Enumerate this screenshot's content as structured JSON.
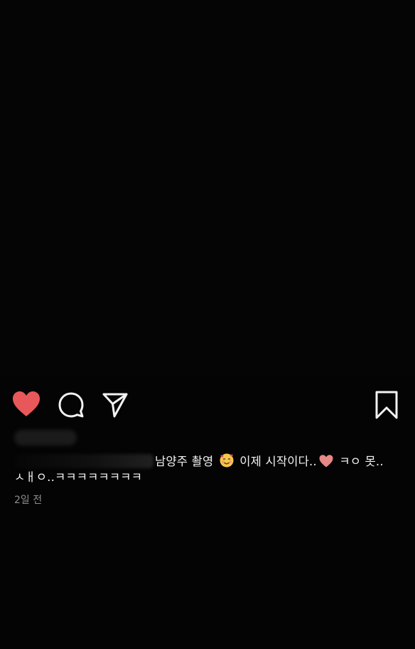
{
  "post": {
    "caption_part1": "남양주 촬영",
    "caption_part2": "이제 시작이다..",
    "caption_part3": "ㅋㅇ 못..",
    "caption_line2": "ㅅㅐㅇ..ㅋㅋㅋㅋㅋㅋㅋㅋ",
    "timestamp": "2일 전"
  },
  "icons": {
    "like": "heart-icon",
    "comment": "comment-icon",
    "share": "paper-plane-icon",
    "save": "bookmark-icon",
    "smiling_face": "smiling-face-with-hearts-emoji",
    "heart_emoji": "heart-emoji"
  },
  "colors": {
    "background": "#040404",
    "like_red": "#e8585a",
    "text": "#f2f2f2",
    "muted": "#8e8e8e"
  }
}
